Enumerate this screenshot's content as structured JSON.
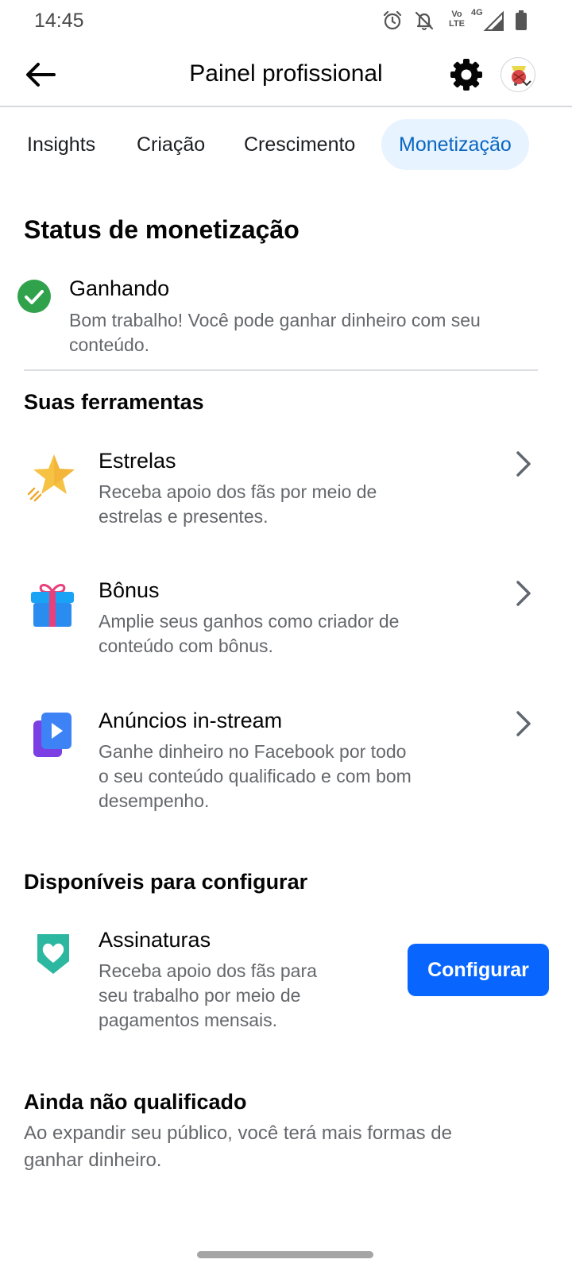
{
  "status_bar": {
    "time": "14:45",
    "icons": [
      "alarm-icon",
      "bell-off-icon",
      "volte-icon",
      "signal-4g-icon",
      "signal-icon",
      "battery-icon"
    ],
    "volte_label": "Vo LTE",
    "network_label": "4G"
  },
  "header": {
    "title": "Painel profissional",
    "back_icon": "arrow-left-icon",
    "settings_icon": "gear-icon"
  },
  "tabs": [
    {
      "label": "Insights",
      "active": false
    },
    {
      "label": "Criação",
      "active": false
    },
    {
      "label": "Crescimento",
      "active": false
    },
    {
      "label": "Monetização",
      "active": true
    }
  ],
  "status": {
    "title": "Status de monetização",
    "state_label": "Ganhando",
    "state_desc_1": "Bom trabalho! Você pode ganhar dinheiro com seu",
    "state_desc_2": "conteúdo."
  },
  "tools": {
    "title": "Suas ferramentas",
    "items": [
      {
        "icon": "star-icon",
        "title": "Estrelas",
        "desc_1": "Receba apoio dos fãs por meio de",
        "desc_2": "estrelas e presentes."
      },
      {
        "icon": "gift-icon",
        "title": "Bônus",
        "desc_1": "Amplie seus ganhos como criador de",
        "desc_2": "conteúdo com bônus."
      },
      {
        "icon": "play-video-icon",
        "title": "Anúncios in-stream",
        "desc_1": "Ganhe dinheiro no Facebook por todo",
        "desc_2": "o seu conteúdo qualificado e com bom",
        "desc_3": "desempenho."
      }
    ]
  },
  "available": {
    "title": "Disponíveis para configurar",
    "item": {
      "icon": "heart-badge-icon",
      "title": "Assinaturas",
      "desc_1": "Receba apoio dos fãs para",
      "desc_2": "seu trabalho por meio de",
      "desc_3": "pagamentos mensais.",
      "button_label": "Configurar"
    }
  },
  "not_qualified": {
    "title": "Ainda não qualificado",
    "desc_1": "Ao expandir seu público, você terá mais formas de",
    "desc_2": "ganhar dinheiro."
  },
  "colors": {
    "accent": "#0866ff",
    "active_tab_bg": "#e7f3ff",
    "active_tab_text": "#0a66c2",
    "success": "#31a24c"
  }
}
